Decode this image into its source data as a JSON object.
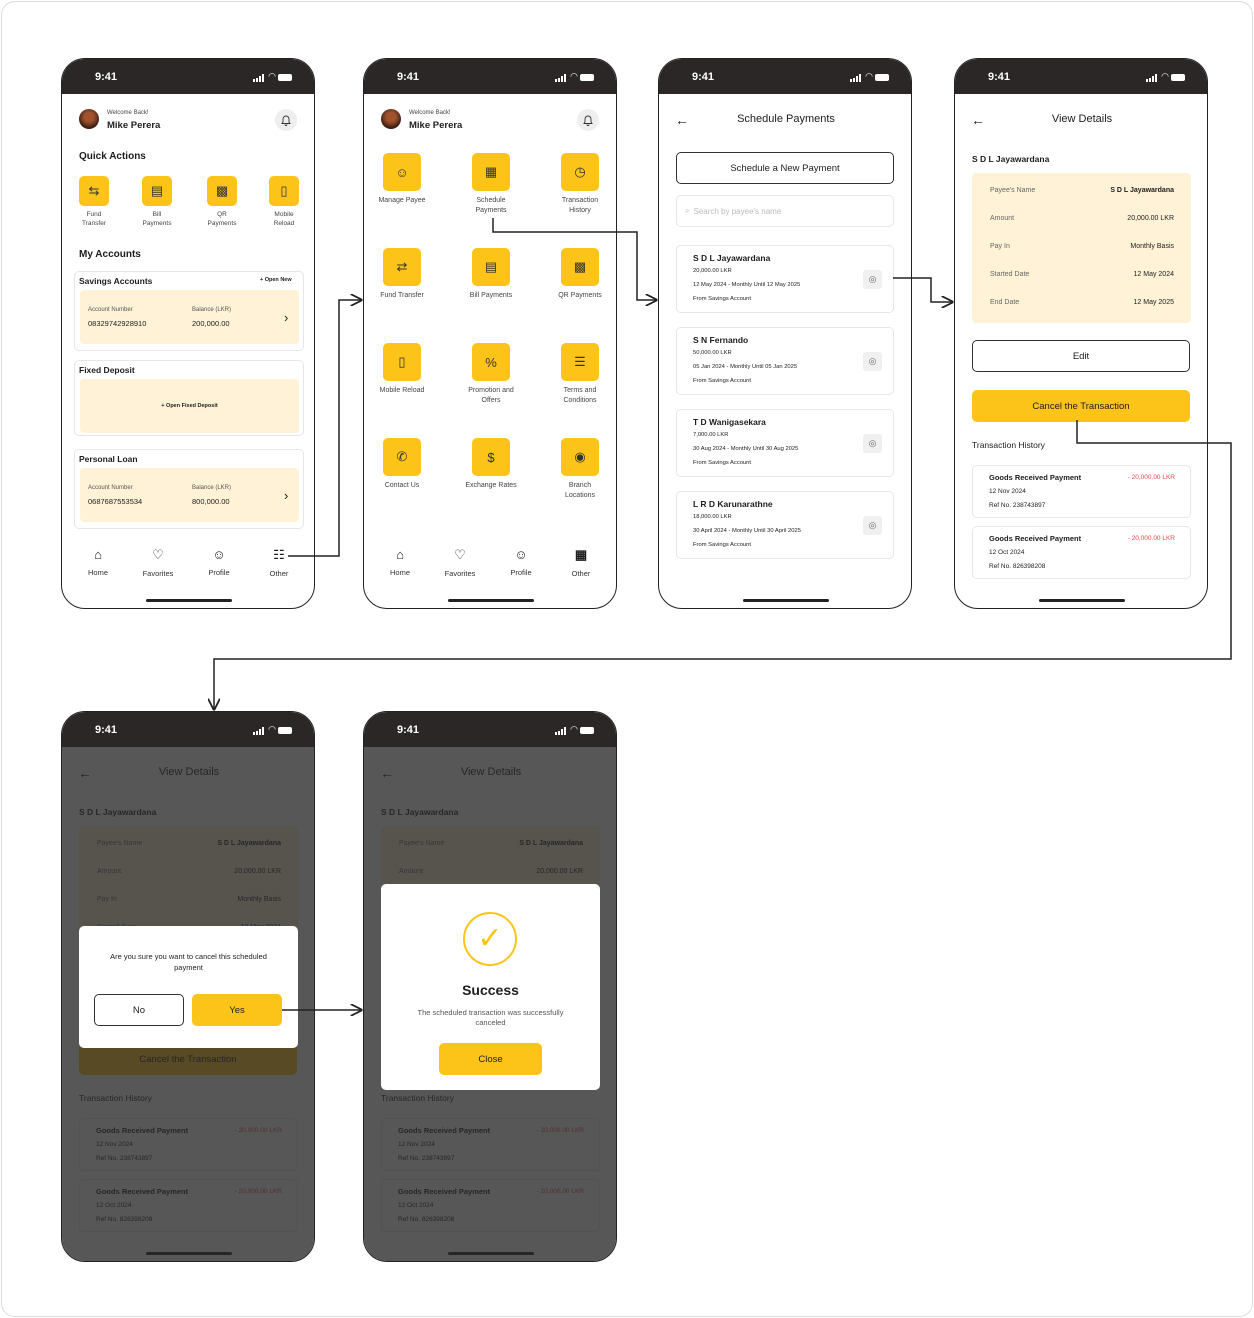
{
  "status_time": "9:41",
  "colors": {
    "accent": "#fcc419",
    "pale": "#fff2d6",
    "debit": "#e5484d",
    "statusbar": "#2b2727"
  },
  "header": {
    "welcome": "Welcome Back!",
    "name": "Mike Perera"
  },
  "nav": [
    "Home",
    "Favorites",
    "Profile",
    "Other"
  ],
  "home": {
    "quick_title": "Quick Actions",
    "quick": [
      {
        "label": "Fund Transfer",
        "icon": "transfer-icon"
      },
      {
        "label": "Bill Payments",
        "icon": "bill-icon"
      },
      {
        "label": "QR Payments",
        "icon": "qr-icon"
      },
      {
        "label": "Mobile Reload",
        "icon": "mobile-icon"
      }
    ],
    "accounts_title": "My Accounts",
    "savings": {
      "title": "Savings Accounts",
      "action": "+ Open New",
      "acc_label": "Account Number",
      "acc": "08329742928910",
      "bal_label": "Balance (LKR)",
      "bal": "200,000.00"
    },
    "fixed": {
      "title": "Fixed Deposit",
      "action": "+ Open Fixed Deposit"
    },
    "loan": {
      "title": "Personal Loan",
      "acc_label": "Account Number",
      "acc": "0687687553534",
      "bal_label": "Balance (LKR)",
      "bal": "800,000.00"
    }
  },
  "menu": [
    {
      "label": "Manage Payee",
      "g": "☺"
    },
    {
      "label": "Schedule Payments",
      "g": "▦"
    },
    {
      "label": "Transaction History",
      "g": "◷"
    },
    {
      "label": "Fund Transfer",
      "g": "⇄"
    },
    {
      "label": "Bill Payments",
      "g": "▤"
    },
    {
      "label": "QR Payments",
      "g": "▩"
    },
    {
      "label": "Mobile Reload",
      "g": "▯"
    },
    {
      "label": "Promotion and Offers",
      "g": "%"
    },
    {
      "label": "Terms and Conditions",
      "g": "☰"
    },
    {
      "label": "Contact Us",
      "g": "✆"
    },
    {
      "label": "Exchange Rates",
      "g": "$"
    },
    {
      "label": "Branch Locations",
      "g": "◉"
    }
  ],
  "schedule": {
    "title": "Schedule Payments",
    "new_btn": "Schedule a New Payment",
    "search_placeholder": "Search by payee's name",
    "items": [
      {
        "name": "S D L Jayawardana",
        "amount": "20,000.00 LKR",
        "period": "12 May 2024 - Monthly Until 12 May 2025",
        "from": "From Savings Account"
      },
      {
        "name": "S N Fernando",
        "amount": "50,000.00 LKR",
        "period": "05 Jan 2024 - Monthly Until 05 Jan 2025",
        "from": "From Savings Account"
      },
      {
        "name": "T D Wanigasekara",
        "amount": "7,000.00 LKR",
        "period": "30 Aug 2024 - Monthly Until 30 Aug 2025",
        "from": "From Savings Account"
      },
      {
        "name": "L R D Karunarathne",
        "amount": "18,000.00 LKR",
        "period": "30 April 2024 - Monthly Until 30 April 2025",
        "from": "From Savings Account"
      }
    ]
  },
  "details": {
    "title": "View Details",
    "payee": "S D L Jayawardana",
    "rows": [
      {
        "k": "Payee's Name",
        "v": "S D L Jayawardana"
      },
      {
        "k": "Amount",
        "v": "20,000.00 LKR"
      },
      {
        "k": "Pay In",
        "v": "Monthly Basis"
      },
      {
        "k": "Started Date",
        "v": "12 May 2024"
      },
      {
        "k": "End Date",
        "v": "12 May 2025"
      }
    ],
    "edit": "Edit",
    "cancel": "Cancel the Transaction",
    "history_title": "Transaction History",
    "history": [
      {
        "title": "Goods Received Payment",
        "amount": "- 20,000.00 LKR",
        "date": "12 Nov 2024",
        "ref": "Ref No. 238743897"
      },
      {
        "title": "Goods Received Payment",
        "amount": "- 20,000.00 LKR",
        "date": "12 Oct 2024",
        "ref": "Ref No. 826398208"
      }
    ]
  },
  "confirm": {
    "message": "Are you sure you want to cancel this scheduled payment",
    "no": "No",
    "yes": "Yes"
  },
  "success": {
    "title": "Success",
    "message": "The scheduled transaction was successfully canceled",
    "close": "Close"
  }
}
